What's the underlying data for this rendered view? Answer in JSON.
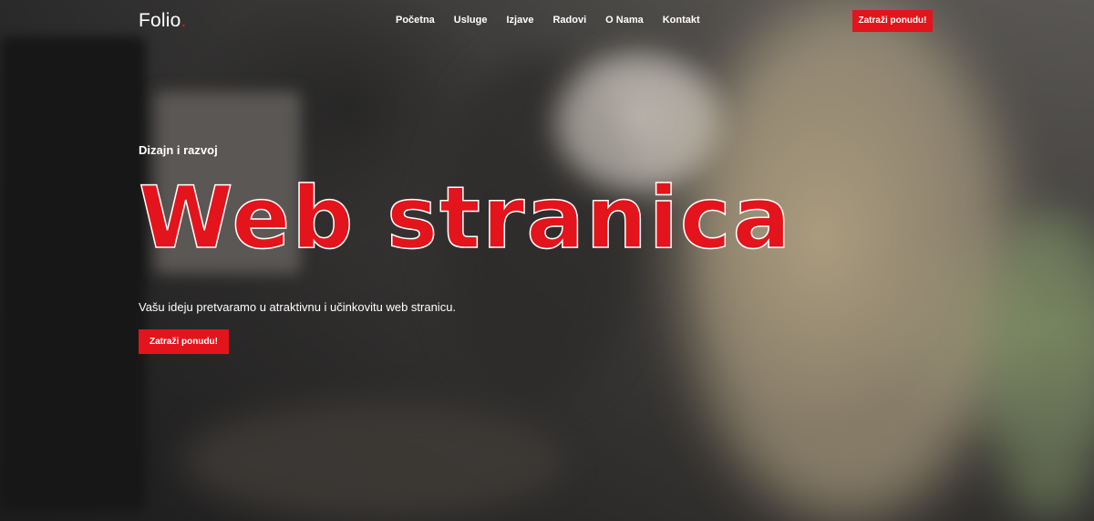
{
  "brand": {
    "name": "Folio",
    "dot": "."
  },
  "nav": {
    "items": [
      {
        "label": "Početna"
      },
      {
        "label": "Usluge"
      },
      {
        "label": "Izjave"
      },
      {
        "label": "Radovi"
      },
      {
        "label": "O Nama"
      },
      {
        "label": "Kontakt"
      }
    ],
    "cta_label": "Zatraži ponudu!"
  },
  "hero": {
    "kicker": "Dizajn i razvoj",
    "title": "Web stranica",
    "subtitle": "Vašu ideju pretvaramo u atraktivnu i učinkovitu web stranicu.",
    "cta_label": "Zatraži ponudu!"
  },
  "colors": {
    "accent": "#e3141b",
    "text": "#ffffff"
  }
}
